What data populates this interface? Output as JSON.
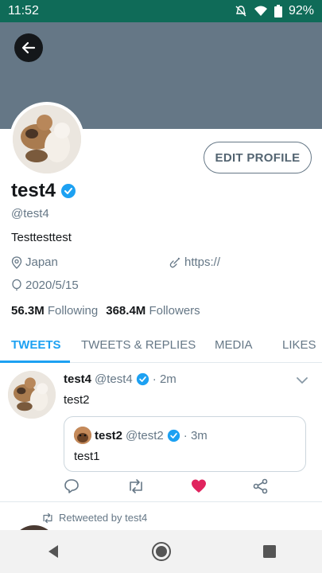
{
  "status_bar": {
    "time": "11:52",
    "battery": "92%"
  },
  "profile": {
    "name": "test4",
    "handle": "@test4",
    "bio": "Testtesttest",
    "location": "Japan",
    "website": "https://",
    "birthday": "2020/5/15",
    "following_count": "56.3M",
    "following_label": "Following",
    "followers_count": "368.4M",
    "followers_label": "Followers",
    "edit_button": "EDIT PROFILE"
  },
  "tabs": [
    {
      "label": "TWEETS",
      "active": true
    },
    {
      "label": "TWEETS & REPLIES",
      "active": false
    },
    {
      "label": "MEDIA",
      "active": false
    },
    {
      "label": "LIKES",
      "active": false
    }
  ],
  "tweet": {
    "name": "test4",
    "handle": "@test4",
    "time": "· 2m",
    "text": "test2",
    "quote": {
      "name": "test2",
      "handle": "@test2",
      "time": "· 3m",
      "text": "test1"
    },
    "liked": true
  },
  "next_item": {
    "retweeted_by": "Retweeted by test4"
  },
  "colors": {
    "accent": "#1da1f2",
    "like": "#e0245e",
    "status_bar": "#0f6b58",
    "banner": "#657786"
  },
  "icons": [
    "back-arrow-icon",
    "verified-icon",
    "location-icon",
    "link-icon",
    "balloon-icon",
    "chevron-down-icon",
    "reply-icon",
    "retweet-icon",
    "heart-icon",
    "share-icon"
  ]
}
